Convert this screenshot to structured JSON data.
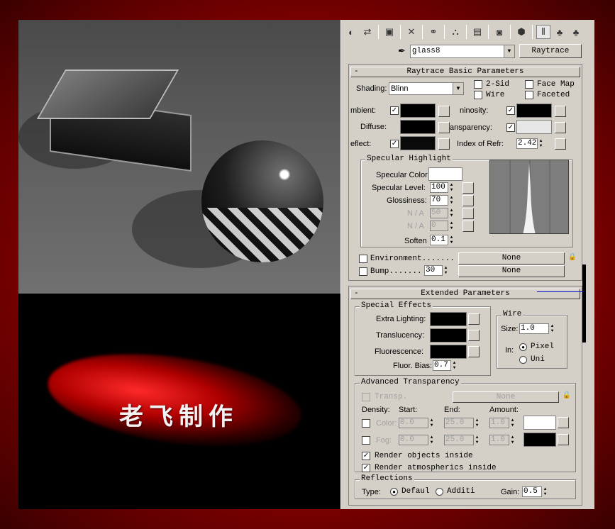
{
  "banner": {
    "title": "老飞制作"
  },
  "toolbar": {
    "icons": [
      "get-material-icon",
      "put-to-scene-icon",
      "assign-material-icon",
      "reset-icon",
      "make-unique-icon",
      "put-to-library-icon",
      "material-effects-icon",
      "show-map-icon",
      "show-end-result-icon",
      "go-to-parent-icon",
      "go-forward-icon"
    ]
  },
  "material": {
    "name": "glass8",
    "type_button": "Raytrace"
  },
  "raytrace_basic": {
    "title": "Raytrace Basic Parameters",
    "shading_label": "Shading:",
    "shading_value": "Blinn",
    "opt_2sided": "2-Sid",
    "opt_wire": "Wire",
    "opt_facemap": "Face Map",
    "opt_faceted": "Faceted",
    "ambient_label": "mbient:",
    "diffuse_label": "Diffuse:",
    "reflect_label": "eflect:",
    "luminosity_label": "ninosity:",
    "transparency_label": "ansparency:",
    "ior_label": "Index of Refr:",
    "ior_value": "2.42",
    "colors": {
      "ambient": "#000000",
      "diffuse": "#000000",
      "reflect": "#0a0a0a",
      "luminosity": "#000000",
      "transparency": "#e6e6e6",
      "specular": "#ffffff"
    },
    "specular": {
      "title": "Specular Highlight",
      "color_label": "Specular Color",
      "level_label": "Specular Level:",
      "level_value": "100",
      "gloss_label": "Glossiness:",
      "gloss_value": "70",
      "na1_label": "N / A",
      "na1_value": "50",
      "na2_label": "N / A",
      "na2_value": "0",
      "soften_label": "Soften",
      "soften_value": "0.1"
    },
    "environment_label": "Environment.......",
    "environment_map": "None",
    "bump_label": "Bump.......",
    "bump_value": "30",
    "bump_map": "None"
  },
  "extended": {
    "title": "Extended Parameters",
    "special_effects_title": "Special Effects",
    "extra_lighting_label": "Extra Lighting:",
    "translucency_label": "Translucency:",
    "fluorescence_label": "Fluorescence:",
    "fluor_bias_label": "Fluor. Bias:",
    "fluor_bias_value": "0.7",
    "wire_title": "Wire",
    "wire_size_label": "Size:",
    "wire_size_value": "1.0",
    "wire_in_label": "In:",
    "wire_pixels": "Pixel",
    "wire_units": "Uni",
    "adv_title": "Advanced Transparency",
    "transp_label": "Transp.",
    "transp_map": "None",
    "density_label": "Density:",
    "start_label": "Start:",
    "end_label": "End:",
    "amount_label": "Amount:",
    "color_label": "Color:",
    "color_start": "0.0",
    "color_end": "25.0",
    "color_amount": "1.0",
    "fog_label": "Fog:",
    "fog_start": "0.0",
    "fog_end": "25.0",
    "fog_amount": "1.0",
    "render_objects_inside": "Render objects inside",
    "render_atmospherics_inside": "Render atmospherics inside",
    "reflections_title": "Reflections",
    "type_label": "Type:",
    "type_default": "Defaul",
    "type_additive": "Additi",
    "gain_label": "Gain:",
    "gain_value": "0.5",
    "density_colors": {
      "color": "#ffffff",
      "fog": "#000000"
    }
  }
}
